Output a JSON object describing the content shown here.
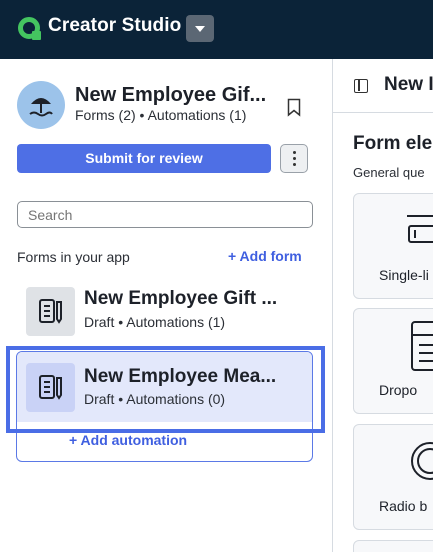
{
  "header": {
    "brand_name": "Creator Studio",
    "brand_dropdown_icon": "chevron-down-icon",
    "brand_color": "#44c560",
    "bar_color": "#0b2338"
  },
  "app": {
    "title": "New Employee Gif...",
    "subtitle": "Forms (2) • Automations (1)",
    "avatar_icon": "beach-umbrella-icon",
    "bookmark_icon": "bookmark-icon"
  },
  "actions": {
    "submit_label": "Submit for review",
    "more_icon": "more-vertical-icon",
    "accent": "#4e6fe5"
  },
  "search": {
    "placeholder": "Search"
  },
  "forms_section": {
    "label": "Forms in your app",
    "add_form_label": "+ Add form",
    "items": [
      {
        "title": "New Employee Gift ...",
        "subtitle": "Draft • Automations (1)",
        "icon": "form-icon"
      },
      {
        "title": "New Employee Mea...",
        "subtitle": "Draft • Automations (0)",
        "icon": "form-icon",
        "selected": true
      }
    ],
    "add_automation_label": "+ Add automation"
  },
  "right_panel": {
    "collapse_icon": "sidebar-collapse-icon",
    "title": "New I",
    "section_title": "Form ele",
    "section_subtitle": "General que",
    "elements": [
      {
        "label": "Single-li",
        "icon": "single-line-icon"
      },
      {
        "label": "Dropo",
        "icon": "dropdown-icon"
      },
      {
        "label": "Radio b",
        "icon": "radio-button-icon"
      }
    ]
  }
}
